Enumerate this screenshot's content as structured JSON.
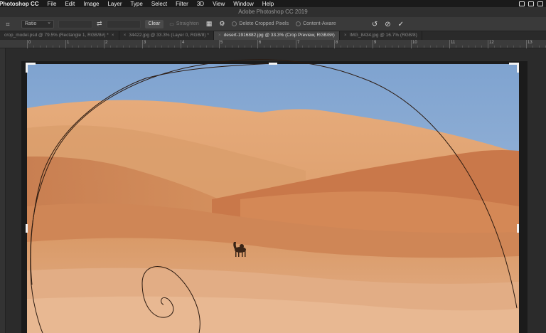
{
  "menubar": {
    "app_name": "Photoshop CC",
    "items": [
      "File",
      "Edit",
      "Image",
      "Layer",
      "Type",
      "Select",
      "Filter",
      "3D",
      "View",
      "Window",
      "Help"
    ]
  },
  "window": {
    "title": "Adobe Photoshop CC 2019"
  },
  "options": {
    "ratio_value": "Ratio",
    "clear_label": "Clear",
    "straighten_label": "Straighten",
    "delete_cropped_label": "Delete Cropped Pixels",
    "content_aware_label": "Content-Aware"
  },
  "tabs": [
    {
      "label": "crop_model.psd @ 79.5% (Rectangle 1, RGB/8#) *",
      "active": false
    },
    {
      "label": "34422.jpg @ 33.3% (Layer 0, RGB/8) *",
      "active": false
    },
    {
      "label": "desert-1916882.jpg @ 33.3% (Crop Preview, RGB/8#)",
      "active": true
    },
    {
      "label": "IMG_8434.jpg @ 16.7% (RGB/8)",
      "active": false
    }
  ],
  "ruler": {
    "labels": [
      "0",
      "1",
      "2",
      "3",
      "4",
      "5",
      "6",
      "7",
      "8",
      "9",
      "10",
      "11",
      "12",
      "13"
    ]
  },
  "colors": {
    "sky": "#8fb0d6",
    "dune_light": "#e0a373",
    "dune_mid": "#cf8a5a",
    "dune_shadow": "#b8683d",
    "overlay_line": "#2a1a12"
  }
}
